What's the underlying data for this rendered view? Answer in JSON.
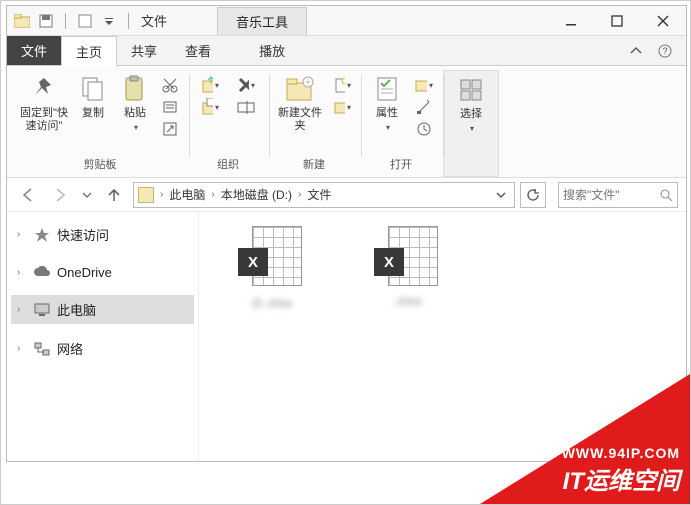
{
  "window": {
    "title": "文件",
    "tool_tab": "音乐工具"
  },
  "tabs": {
    "file": "文件",
    "home": "主页",
    "share": "共享",
    "view": "查看",
    "play": "播放"
  },
  "ribbon": {
    "pin": "固定到\"快速访问\"",
    "copy": "复制",
    "paste": "粘贴",
    "clipboard_group": "剪贴板",
    "organize_group": "组织",
    "new_folder": "新建文件夹",
    "new_group": "新建",
    "properties": "属性",
    "open_group": "打开",
    "select": "选择"
  },
  "breadcrumb": {
    "pc": "此电脑",
    "drive": "本地磁盘 (D:)",
    "folder": "文件"
  },
  "search": {
    "placeholder": "搜索\"文件\""
  },
  "sidebar": {
    "items": [
      {
        "label": "快速访问"
      },
      {
        "label": "OneDrive"
      },
      {
        "label": "此电脑"
      },
      {
        "label": "网络"
      }
    ]
  },
  "files": {
    "items": [
      {
        "name": "小.xlsx"
      },
      {
        "name": ".xlsx"
      }
    ]
  },
  "watermark": {
    "url": "WWW.94IP.COM",
    "name": "IT运维空间"
  }
}
